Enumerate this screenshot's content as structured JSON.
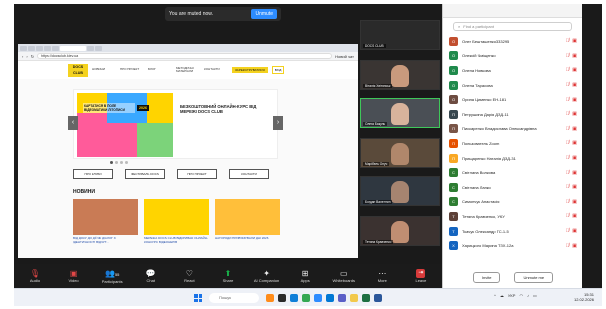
{
  "toast": {
    "text": "You are muted now.",
    "button": "Unmute"
  },
  "browser": {
    "url": "https://docsclub.kiev.ua",
    "zoom": "Новий чат"
  },
  "site": {
    "logo_line1": "DOCS",
    "logo_line2": "CLUB",
    "nav": [
      "НОВИНИ",
      "ПРО ПРОЕКТ",
      "БЛОГ",
      "МЕТОДИЧНІ МАТЕРІАЛИ",
      "КОНТАКТИ"
    ],
    "cta_yellow": "ЗАРЕЄСТРУВАТИСЯ",
    "cta_outline": "ВХІД",
    "hero_title": "БЕЗКОШТОВНИЙ ОНЛАЙН-КУРС ВІД МЕРЕЖІ DOCS CLUB",
    "poster_text": "КАРТАТИСЯ В ПОЛЕ ВІДЕОМАТИКИ ЛІТОПИСИ",
    "poster_year": "2026",
    "pills": [
      "ПРО КЛУБИ",
      "ФЕСТИВАЛЬ DOCS",
      "ПРО ПРОЕКТ",
      "КОНТАКТИ"
    ],
    "news_header": "НОВИНИ",
    "news": [
      "ВІД ДОКУ ДО ДІЇ ЯК ДІАЛОГ З ІДЕНТИЧНОСТІ ВІДЧУТ...",
      "МЕРЕЖА DOCS CLUB ВІДКРИВАЄ ОНЛАЙН-КОНКУРС ВІДЕОНЕРІВ",
      "НАГОРОДИ ПРИВ'ЯЗУВАЛИ ДНІ 2026"
    ]
  },
  "tiles": [
    {
      "label": "DOCS CLUB"
    },
    {
      "label": "Віталія Хвітянськ"
    },
    {
      "label": "Олега Бакуль"
    },
    {
      "label": "Марібель Онуч"
    },
    {
      "label": "Богдан Валентин"
    },
    {
      "label": "Тетяна Кравченко"
    }
  ],
  "toolbar": [
    {
      "label": "Audio",
      "icon": "microphone-muted-icon"
    },
    {
      "label": "Video",
      "icon": "camera-off-icon"
    },
    {
      "label": "Participants",
      "count": "55",
      "icon": "participants-icon"
    },
    {
      "label": "Chat",
      "icon": "chat-icon"
    },
    {
      "label": "React",
      "icon": "heart-icon"
    },
    {
      "label": "Share",
      "icon": "share-icon"
    },
    {
      "label": "AI Companion",
      "icon": "sparkle-icon"
    },
    {
      "label": "Apps",
      "icon": "apps-icon"
    },
    {
      "label": "Whiteboards",
      "icon": "whiteboard-icon"
    },
    {
      "label": "More",
      "icon": "more-icon"
    },
    {
      "label": "Leave",
      "icon": "leave-icon"
    }
  ],
  "panel": {
    "search_placeholder": "Find a participant",
    "participants": [
      {
        "name": "Олег Бешташенко333295",
        "initial": "О",
        "color": "#c24f2f"
      },
      {
        "name": "Олексій Чміщенко",
        "initial": "О",
        "color": "#1f8a4c"
      },
      {
        "name": "Олена Новкова",
        "initial": "О",
        "color": "#1f8a4c"
      },
      {
        "name": "Олена Тарасова",
        "initial": "О",
        "color": "#1f8a4c"
      },
      {
        "name": "Орина Цименко ЕН-181",
        "initial": "О",
        "color": "#6d4c41"
      },
      {
        "name": "Петрушина Дарія ДЗД-11",
        "initial": "П",
        "color": "#37474f"
      },
      {
        "name": "Пискаренко Владислава Олександрівна",
        "initial": "П",
        "color": "#795548"
      },
      {
        "name": "Пользователь Zoom",
        "initial": "П",
        "color": "#e65100"
      },
      {
        "name": "Прищаренко Наталія ДЗД-31",
        "initial": "П",
        "color": "#f9a825"
      },
      {
        "name": "Світлана Волкова",
        "initial": "С",
        "color": "#2e7d32"
      },
      {
        "name": "Світлана Лапко",
        "initial": "С",
        "color": "#2e7d32"
      },
      {
        "name": "Симончук Анастасія",
        "initial": "С",
        "color": "#2e7d32"
      },
      {
        "name": "Тетяна Кравченко, УКУ",
        "initial": "Т",
        "color": "#5d4037"
      },
      {
        "name": "Ткачук Олександр ГС-1-5",
        "initial": "Т",
        "color": "#1565c0"
      },
      {
        "name": "Харицкого Марина ТЗХ-12а",
        "initial": "Х",
        "color": "#1565c0"
      }
    ],
    "invite": "Invite",
    "unmute": "Unmute me"
  },
  "taskbar": {
    "search": "Пошук",
    "lang": "УКР",
    "time": "15:31",
    "date": "12.02.2026"
  }
}
